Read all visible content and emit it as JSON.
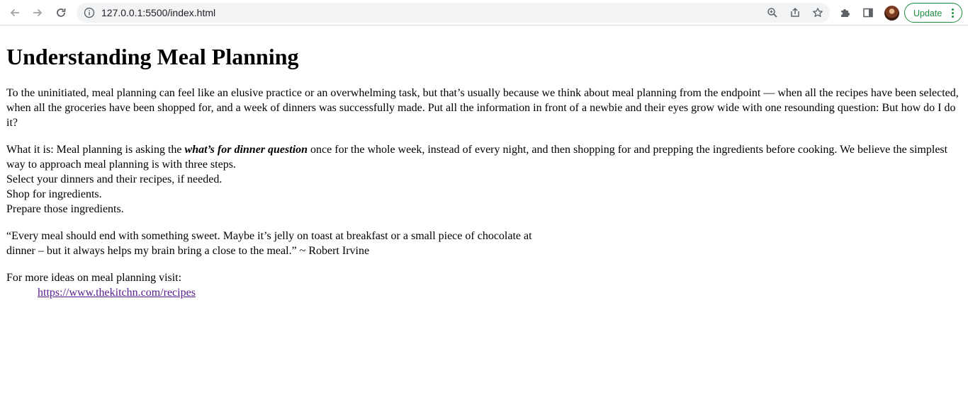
{
  "browser": {
    "url": "127.0.0.1:5500/index.html",
    "update_label": "Update",
    "icons": {
      "back": "back-arrow-icon",
      "forward": "forward-arrow-icon",
      "reload": "reload-icon",
      "info": "site-info-icon",
      "zoom": "zoom-icon",
      "share": "share-icon",
      "bookmark": "star-icon",
      "extensions": "puzzle-icon",
      "side_panel": "side-panel-icon",
      "menu": "kebab-menu-icon"
    },
    "colors": {
      "update_green": "#1e8e3e",
      "omnibox_bg": "#f1f3f4"
    }
  },
  "page": {
    "title": "Understanding Meal Planning",
    "intro": "To the uninitiated, meal planning can feel like an elusive practice or an overwhelming task, but that’s usually because we think about meal planning from the endpoint — when all the recipes have been selected, when all the groceries have been shopped for, and a week of dinners was successfully made. Put all the information in front of a newbie and their eyes grow wide with one resounding question: But how do I do it?",
    "what_prefix": "What it is: Meal planning is asking the ",
    "what_emphasis": "what’s for dinner question",
    "what_suffix": " once for the whole week, instead of every night, and then shopping for and prepping the ingredients before cooking. We believe the simplest way to approach meal planning is with three steps.",
    "steps": [
      "Select your dinners and their recipes, if needed.",
      "Shop for ingredients.",
      "Prepare those ingredients."
    ],
    "quote_line1": "“Every meal should end with something sweet. Maybe it’s jelly on toast at breakfast or a small piece of chocolate at",
    "quote_line2": "dinner – but it always helps my brain bring a close to the meal.” ~ Robert Irvine",
    "more_ideas": "For more ideas on meal planning visit:",
    "link_text": "https://www.thekitchn.com/recipes",
    "link_color": "#551a8b"
  }
}
